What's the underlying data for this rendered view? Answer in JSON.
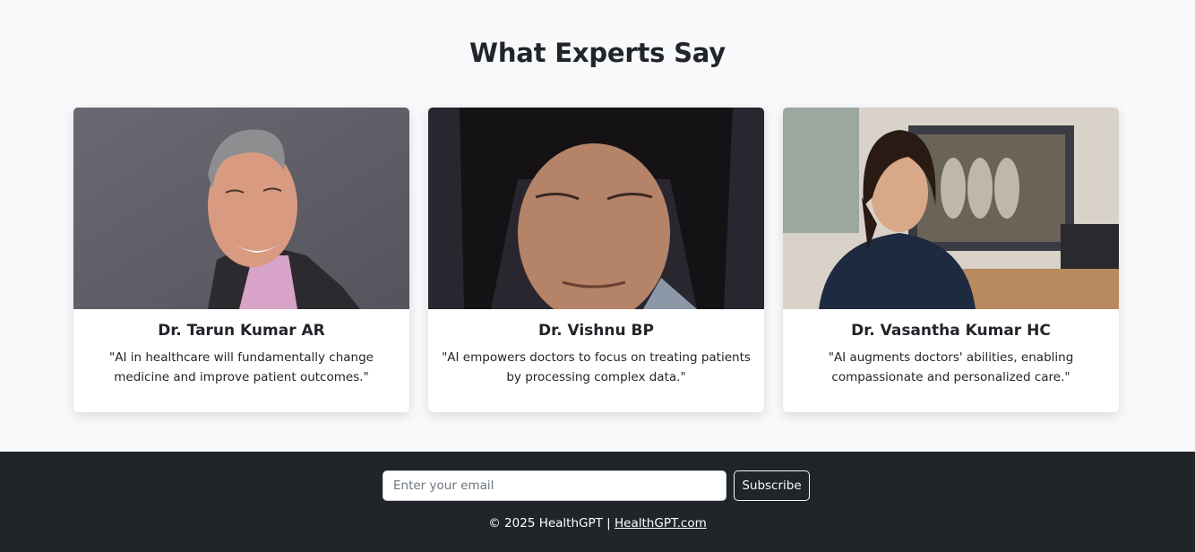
{
  "section": {
    "title": "What Experts Say"
  },
  "experts": [
    {
      "name": "Dr. Tarun Kumar AR",
      "quote": "\"AI in healthcare will fundamentally change medicine and improve patient outcomes.\""
    },
    {
      "name": "Dr. Vishnu BP",
      "quote": "\"AI empowers doctors to focus on treating patients by processing complex data.\""
    },
    {
      "name": "Dr. Vasantha Kumar HC",
      "quote": "\"AI augments doctors' abilities, enabling compassionate and personalized care.\""
    }
  ],
  "footer": {
    "email_placeholder": "Enter your email",
    "subscribe_label": "Subscribe",
    "copyright": "© 2025 HealthGPT |",
    "link_text": "HealthGPT.com"
  },
  "colors": {
    "page_bg": "#f8f9fa",
    "footer_bg": "#212529",
    "text": "#212529"
  }
}
